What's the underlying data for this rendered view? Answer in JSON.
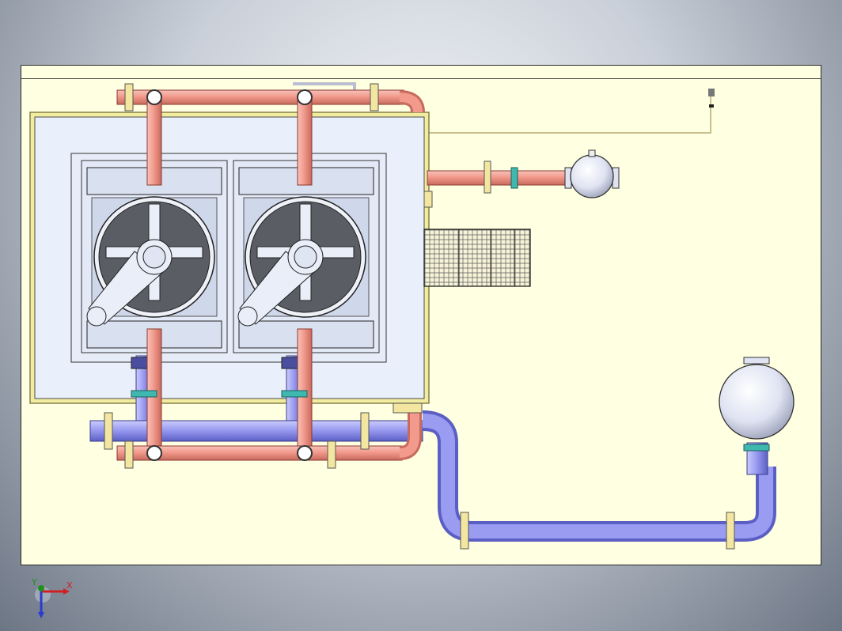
{
  "viewport": {
    "background": "#c9cfd8",
    "sheet_color": "#ffffe1"
  },
  "colors": {
    "hot_pipe": "#f29a8c",
    "hot_pipe_dark": "#c86a5e",
    "cold_pipe": "#9a9cf2",
    "cold_pipe_dark": "#5b5fc4",
    "flange": "#f3e6a0",
    "coupling": "#3fb8b0",
    "unit_panel": "#eaf0fb",
    "fan_disc": "#5a5d63",
    "frame_yellow": "#f2eca0"
  },
  "icons": {
    "triad": "coordinate-triad-icon",
    "fan": "fan-icon",
    "tank": "pressure-vessel-icon",
    "heat_exchanger": "plate-heat-exchanger-icon"
  },
  "triad": {
    "x_label": "X",
    "y_label": "Y"
  }
}
